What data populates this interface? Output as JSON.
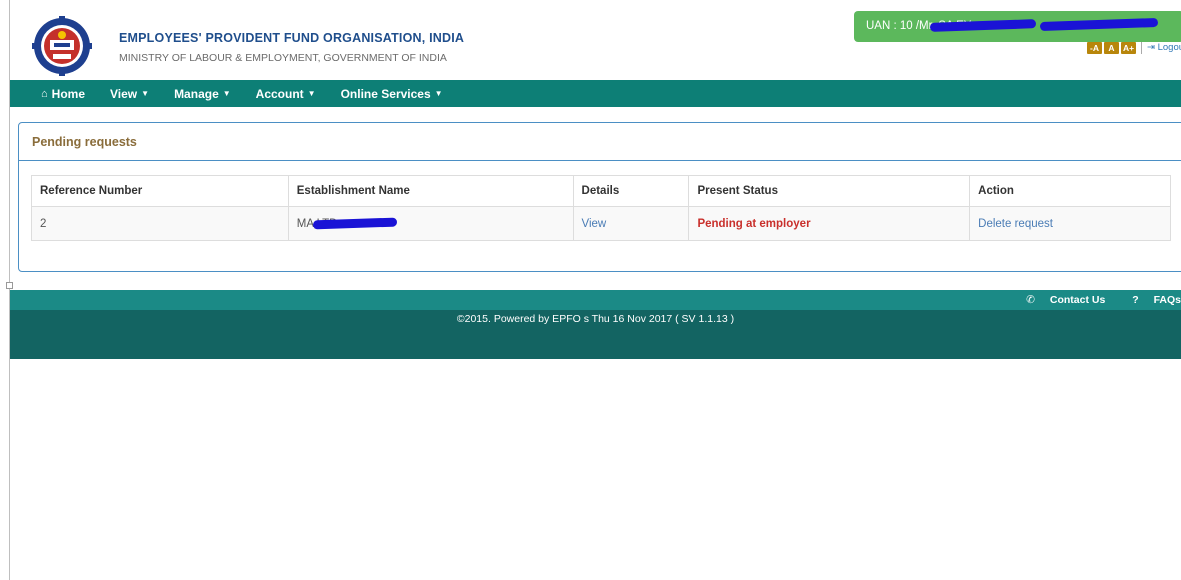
{
  "header": {
    "org_title": "EMPLOYEES' PROVIDENT FUND ORGANISATION, INDIA",
    "org_subtitle": "MINISTRY OF LABOUR & EMPLOYMENT, GOVERNMENT OF INDIA",
    "logo_icon": "epfo-emblem-icon",
    "uan_text": "UAN : 10       /Mr. SA                     EY",
    "font_sizes": [
      "-A",
      "A",
      "A+"
    ],
    "logout_label": "Logout",
    "logout_icon": "sign-out-icon"
  },
  "nav": {
    "home": "Home",
    "home_icon": "home-icon",
    "items": [
      "View",
      "Manage",
      "Account",
      "Online Services"
    ],
    "caret_icon": "caret-down-icon"
  },
  "panel": {
    "title": "Pending requests",
    "columns": [
      "Reference Number",
      "Establishment Name",
      "Details",
      "Present Status",
      "Action"
    ],
    "rows": [
      {
        "reference": "2",
        "establishment": "MA                LTD",
        "details": "View",
        "status": "Pending at employer",
        "action": "Delete request"
      }
    ]
  },
  "footer": {
    "contact": "Contact Us",
    "contact_icon": "phone-icon",
    "faq": "FAQs",
    "faq_icon": "question-icon",
    "copyright": "©2015. Powered by EPFO s Thu 16 Nov 2017 ( SV 1.1.13 )"
  },
  "colors": {
    "navbar": "#0d7f76",
    "uan_box": "#5cb85c",
    "status_pending": "#c9302c",
    "footer_top": "#1b8a86",
    "footer_bottom": "#136462",
    "redaction": "#1a13d6"
  }
}
